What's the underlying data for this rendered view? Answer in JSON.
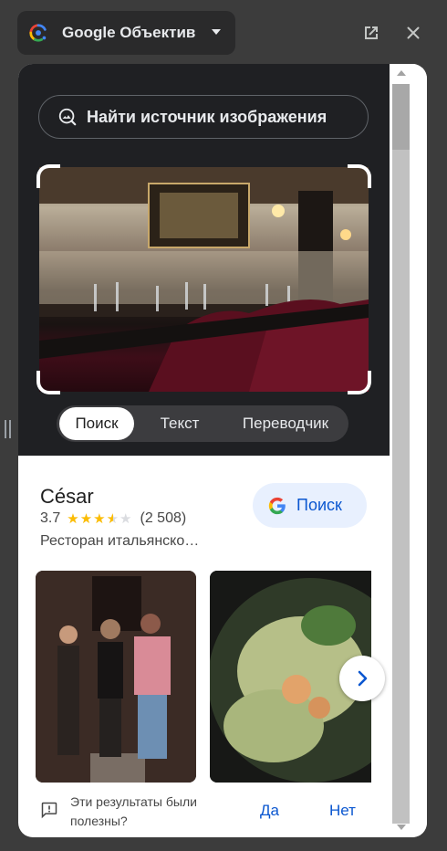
{
  "header": {
    "app_title": "Google Объектив",
    "icons": [
      "google-lens-logo",
      "chevron-down-icon",
      "open-in-new-icon",
      "close-icon"
    ]
  },
  "lens": {
    "find_source_label": "Найти источник изображения",
    "modes": [
      {
        "label": "Поиск",
        "active": true
      },
      {
        "label": "Текст",
        "active": false
      },
      {
        "label": "Переводчик",
        "active": false
      }
    ]
  },
  "result": {
    "name": "César",
    "rating": "3.7",
    "stars": 3.5,
    "review_count": "(2 508)",
    "category": "Ресторан итальянско…",
    "search_button_label": "Поиск"
  },
  "feedback": {
    "question": "Эти результаты были полезны?",
    "yes_label": "Да",
    "no_label": "Нет"
  },
  "colors": {
    "accent_blue": "#0b57d0",
    "star_yellow": "#fbbc04",
    "dark_panel": "#1f2023"
  }
}
